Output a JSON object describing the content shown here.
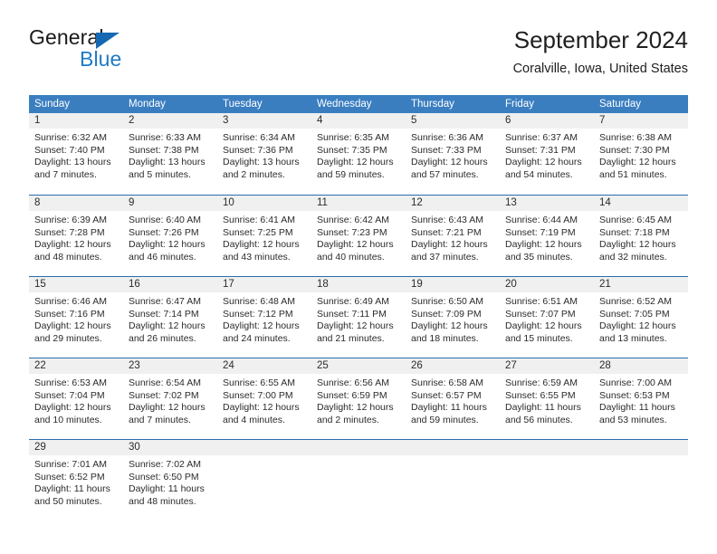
{
  "logo": {
    "word_top": "General",
    "word_bottom": "Blue",
    "triangle_color": "#1668b3",
    "blue_color": "#1f7ac4"
  },
  "header": {
    "title": "September 2024",
    "subtitle": "Coralville, Iowa, United States"
  },
  "theme": {
    "header_bg": "#3a7ec0",
    "row_divider": "#2a6daf",
    "day_band_bg": "#f0f0f0"
  },
  "weekdays": [
    "Sunday",
    "Monday",
    "Tuesday",
    "Wednesday",
    "Thursday",
    "Friday",
    "Saturday"
  ],
  "labels": {
    "sunrise_prefix": "Sunrise:",
    "sunset_prefix": "Sunset:",
    "daylight_prefix": "Daylight:"
  },
  "weeks": [
    [
      {
        "day": "1",
        "sunrise": "Sunrise: 6:32 AM",
        "sunset": "Sunset: 7:40 PM",
        "daylight_l1": "Daylight: 13 hours",
        "daylight_l2": "and 7 minutes."
      },
      {
        "day": "2",
        "sunrise": "Sunrise: 6:33 AM",
        "sunset": "Sunset: 7:38 PM",
        "daylight_l1": "Daylight: 13 hours",
        "daylight_l2": "and 5 minutes."
      },
      {
        "day": "3",
        "sunrise": "Sunrise: 6:34 AM",
        "sunset": "Sunset: 7:36 PM",
        "daylight_l1": "Daylight: 13 hours",
        "daylight_l2": "and 2 minutes."
      },
      {
        "day": "4",
        "sunrise": "Sunrise: 6:35 AM",
        "sunset": "Sunset: 7:35 PM",
        "daylight_l1": "Daylight: 12 hours",
        "daylight_l2": "and 59 minutes."
      },
      {
        "day": "5",
        "sunrise": "Sunrise: 6:36 AM",
        "sunset": "Sunset: 7:33 PM",
        "daylight_l1": "Daylight: 12 hours",
        "daylight_l2": "and 57 minutes."
      },
      {
        "day": "6",
        "sunrise": "Sunrise: 6:37 AM",
        "sunset": "Sunset: 7:31 PM",
        "daylight_l1": "Daylight: 12 hours",
        "daylight_l2": "and 54 minutes."
      },
      {
        "day": "7",
        "sunrise": "Sunrise: 6:38 AM",
        "sunset": "Sunset: 7:30 PM",
        "daylight_l1": "Daylight: 12 hours",
        "daylight_l2": "and 51 minutes."
      }
    ],
    [
      {
        "day": "8",
        "sunrise": "Sunrise: 6:39 AM",
        "sunset": "Sunset: 7:28 PM",
        "daylight_l1": "Daylight: 12 hours",
        "daylight_l2": "and 48 minutes."
      },
      {
        "day": "9",
        "sunrise": "Sunrise: 6:40 AM",
        "sunset": "Sunset: 7:26 PM",
        "daylight_l1": "Daylight: 12 hours",
        "daylight_l2": "and 46 minutes."
      },
      {
        "day": "10",
        "sunrise": "Sunrise: 6:41 AM",
        "sunset": "Sunset: 7:25 PM",
        "daylight_l1": "Daylight: 12 hours",
        "daylight_l2": "and 43 minutes."
      },
      {
        "day": "11",
        "sunrise": "Sunrise: 6:42 AM",
        "sunset": "Sunset: 7:23 PM",
        "daylight_l1": "Daylight: 12 hours",
        "daylight_l2": "and 40 minutes."
      },
      {
        "day": "12",
        "sunrise": "Sunrise: 6:43 AM",
        "sunset": "Sunset: 7:21 PM",
        "daylight_l1": "Daylight: 12 hours",
        "daylight_l2": "and 37 minutes."
      },
      {
        "day": "13",
        "sunrise": "Sunrise: 6:44 AM",
        "sunset": "Sunset: 7:19 PM",
        "daylight_l1": "Daylight: 12 hours",
        "daylight_l2": "and 35 minutes."
      },
      {
        "day": "14",
        "sunrise": "Sunrise: 6:45 AM",
        "sunset": "Sunset: 7:18 PM",
        "daylight_l1": "Daylight: 12 hours",
        "daylight_l2": "and 32 minutes."
      }
    ],
    [
      {
        "day": "15",
        "sunrise": "Sunrise: 6:46 AM",
        "sunset": "Sunset: 7:16 PM",
        "daylight_l1": "Daylight: 12 hours",
        "daylight_l2": "and 29 minutes."
      },
      {
        "day": "16",
        "sunrise": "Sunrise: 6:47 AM",
        "sunset": "Sunset: 7:14 PM",
        "daylight_l1": "Daylight: 12 hours",
        "daylight_l2": "and 26 minutes."
      },
      {
        "day": "17",
        "sunrise": "Sunrise: 6:48 AM",
        "sunset": "Sunset: 7:12 PM",
        "daylight_l1": "Daylight: 12 hours",
        "daylight_l2": "and 24 minutes."
      },
      {
        "day": "18",
        "sunrise": "Sunrise: 6:49 AM",
        "sunset": "Sunset: 7:11 PM",
        "daylight_l1": "Daylight: 12 hours",
        "daylight_l2": "and 21 minutes."
      },
      {
        "day": "19",
        "sunrise": "Sunrise: 6:50 AM",
        "sunset": "Sunset: 7:09 PM",
        "daylight_l1": "Daylight: 12 hours",
        "daylight_l2": "and 18 minutes."
      },
      {
        "day": "20",
        "sunrise": "Sunrise: 6:51 AM",
        "sunset": "Sunset: 7:07 PM",
        "daylight_l1": "Daylight: 12 hours",
        "daylight_l2": "and 15 minutes."
      },
      {
        "day": "21",
        "sunrise": "Sunrise: 6:52 AM",
        "sunset": "Sunset: 7:05 PM",
        "daylight_l1": "Daylight: 12 hours",
        "daylight_l2": "and 13 minutes."
      }
    ],
    [
      {
        "day": "22",
        "sunrise": "Sunrise: 6:53 AM",
        "sunset": "Sunset: 7:04 PM",
        "daylight_l1": "Daylight: 12 hours",
        "daylight_l2": "and 10 minutes."
      },
      {
        "day": "23",
        "sunrise": "Sunrise: 6:54 AM",
        "sunset": "Sunset: 7:02 PM",
        "daylight_l1": "Daylight: 12 hours",
        "daylight_l2": "and 7 minutes."
      },
      {
        "day": "24",
        "sunrise": "Sunrise: 6:55 AM",
        "sunset": "Sunset: 7:00 PM",
        "daylight_l1": "Daylight: 12 hours",
        "daylight_l2": "and 4 minutes."
      },
      {
        "day": "25",
        "sunrise": "Sunrise: 6:56 AM",
        "sunset": "Sunset: 6:59 PM",
        "daylight_l1": "Daylight: 12 hours",
        "daylight_l2": "and 2 minutes."
      },
      {
        "day": "26",
        "sunrise": "Sunrise: 6:58 AM",
        "sunset": "Sunset: 6:57 PM",
        "daylight_l1": "Daylight: 11 hours",
        "daylight_l2": "and 59 minutes."
      },
      {
        "day": "27",
        "sunrise": "Sunrise: 6:59 AM",
        "sunset": "Sunset: 6:55 PM",
        "daylight_l1": "Daylight: 11 hours",
        "daylight_l2": "and 56 minutes."
      },
      {
        "day": "28",
        "sunrise": "Sunrise: 7:00 AM",
        "sunset": "Sunset: 6:53 PM",
        "daylight_l1": "Daylight: 11 hours",
        "daylight_l2": "and 53 minutes."
      }
    ],
    [
      {
        "day": "29",
        "sunrise": "Sunrise: 7:01 AM",
        "sunset": "Sunset: 6:52 PM",
        "daylight_l1": "Daylight: 11 hours",
        "daylight_l2": "and 50 minutes."
      },
      {
        "day": "30",
        "sunrise": "Sunrise: 7:02 AM",
        "sunset": "Sunset: 6:50 PM",
        "daylight_l1": "Daylight: 11 hours",
        "daylight_l2": "and 48 minutes."
      },
      {
        "day": "",
        "sunrise": "",
        "sunset": "",
        "daylight_l1": "",
        "daylight_l2": ""
      },
      {
        "day": "",
        "sunrise": "",
        "sunset": "",
        "daylight_l1": "",
        "daylight_l2": ""
      },
      {
        "day": "",
        "sunrise": "",
        "sunset": "",
        "daylight_l1": "",
        "daylight_l2": ""
      },
      {
        "day": "",
        "sunrise": "",
        "sunset": "",
        "daylight_l1": "",
        "daylight_l2": ""
      },
      {
        "day": "",
        "sunrise": "",
        "sunset": "",
        "daylight_l1": "",
        "daylight_l2": ""
      }
    ]
  ]
}
